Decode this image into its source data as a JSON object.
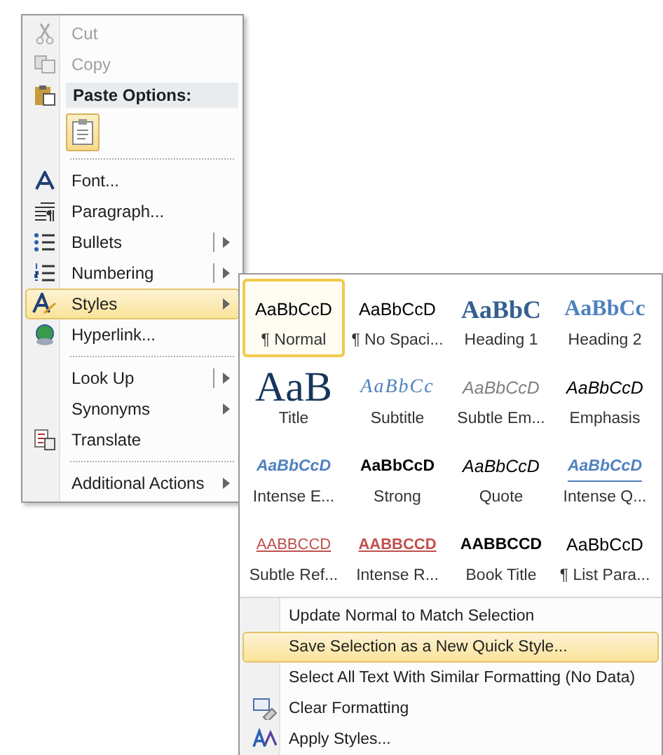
{
  "context_menu": {
    "items": [
      {
        "kind": "item",
        "label": "Cut",
        "disabled": true,
        "selected": false,
        "submenu": false,
        "split": false
      },
      {
        "kind": "item",
        "label": "Copy",
        "disabled": true,
        "selected": false,
        "submenu": false,
        "split": false
      },
      {
        "kind": "header",
        "label": "Paste Options:"
      },
      {
        "kind": "paste"
      },
      {
        "kind": "separator"
      },
      {
        "kind": "item",
        "label": "Font...",
        "disabled": false,
        "selected": false,
        "submenu": false,
        "split": false
      },
      {
        "kind": "item",
        "label": "Paragraph...",
        "disabled": false,
        "selected": false,
        "submenu": false,
        "split": false
      },
      {
        "kind": "item",
        "label": "Bullets",
        "disabled": false,
        "selected": false,
        "submenu": true,
        "split": true
      },
      {
        "kind": "item",
        "label": "Numbering",
        "disabled": false,
        "selected": false,
        "submenu": true,
        "split": true
      },
      {
        "kind": "item",
        "label": "Styles",
        "disabled": false,
        "selected": true,
        "submenu": true,
        "split": false
      },
      {
        "kind": "item",
        "label": "Hyperlink...",
        "disabled": false,
        "selected": false,
        "submenu": false,
        "split": false
      },
      {
        "kind": "separator"
      },
      {
        "kind": "item",
        "label": "Look Up",
        "disabled": false,
        "selected": false,
        "submenu": true,
        "split": true
      },
      {
        "kind": "item",
        "label": "Synonyms",
        "disabled": false,
        "selected": false,
        "submenu": true,
        "split": false
      },
      {
        "kind": "item",
        "label": "Translate",
        "disabled": false,
        "selected": false,
        "submenu": false,
        "split": false
      },
      {
        "kind": "separator"
      },
      {
        "kind": "item",
        "label": "Additional Actions",
        "disabled": false,
        "selected": false,
        "submenu": true,
        "split": false
      }
    ]
  },
  "styles_submenu": {
    "gallery": [
      {
        "preview": "AaBbCcD",
        "name": "¶ Normal",
        "kind": "normal",
        "selected": true
      },
      {
        "preview": "AaBbCcD",
        "name": "¶ No Spaci...",
        "kind": "normal",
        "selected": false
      },
      {
        "preview": "AaBbC",
        "name": "Heading 1",
        "kind": "heading1",
        "selected": false
      },
      {
        "preview": "AaBbCc",
        "name": "Heading 2",
        "kind": "heading2",
        "selected": false
      },
      {
        "preview": "AaB",
        "name": "Title",
        "kind": "title",
        "selected": false
      },
      {
        "preview": "AaBbCc",
        "name": "Subtitle",
        "kind": "subtitle",
        "selected": false
      },
      {
        "preview": "AaBbCcD",
        "name": "Subtle Em...",
        "kind": "subtle",
        "selected": false
      },
      {
        "preview": "AaBbCcD",
        "name": "Emphasis",
        "kind": "emphasis",
        "selected": false
      },
      {
        "preview": "AaBbCcD",
        "name": "Intense E...",
        "kind": "intense",
        "selected": false
      },
      {
        "preview": "AaBbCcD",
        "name": "Strong",
        "kind": "strong",
        "selected": false
      },
      {
        "preview": "AaBbCcD",
        "name": "Quote",
        "kind": "emphasis",
        "selected": false
      },
      {
        "preview": "AaBbCcD",
        "name": "Intense Q...",
        "kind": "intensequote",
        "selected": false
      },
      {
        "preview": "AABBCCD",
        "name": "Subtle Ref...",
        "kind": "subtleref",
        "selected": false
      },
      {
        "preview": "AABBCCD",
        "name": "Intense R...",
        "kind": "intenseref",
        "selected": false
      },
      {
        "preview": "AABBCCD",
        "name": "Book Title",
        "kind": "strong",
        "selected": false
      },
      {
        "preview": "AaBbCcD",
        "name": "¶ List Para...",
        "kind": "normal",
        "selected": false
      }
    ],
    "commands": [
      {
        "label": "Update Normal to Match Selection",
        "selected": false
      },
      {
        "label": "Save Selection as a New Quick Style...",
        "selected": true
      },
      {
        "label": "Select All Text With Similar Formatting (No Data)",
        "selected": false
      },
      {
        "label": "Clear Formatting",
        "selected": false
      },
      {
        "label": "Apply Styles...",
        "selected": false
      }
    ]
  }
}
